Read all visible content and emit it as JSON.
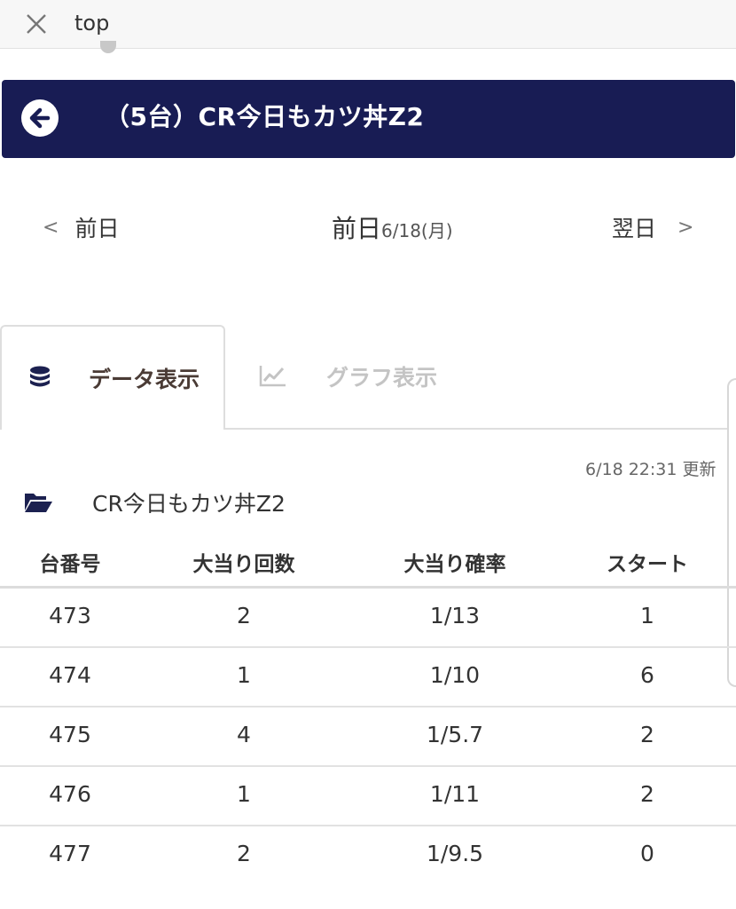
{
  "topbar": {
    "title": "top",
    "close_icon": "close-icon"
  },
  "banner": {
    "title": "（5台）CR今日もカツ丼Z2",
    "back_icon": "arrow-left-circle-icon",
    "bg_color": "#181c54"
  },
  "date_nav": {
    "prev_chevron": "<",
    "prev_label": "前日",
    "current_main": "前日",
    "current_date": "6/18(月)",
    "next_label": "翌日",
    "next_chevron": ">"
  },
  "tabs": [
    {
      "label": "データ表示",
      "icon": "database-icon",
      "active": true
    },
    {
      "label": "グラフ表示",
      "icon": "line-chart-icon",
      "active": false
    }
  ],
  "updated": "6/18 22:31 更新",
  "machine": {
    "icon": "folder-open-icon",
    "name": "CR今日もカツ丼Z2"
  },
  "table": {
    "headers": [
      "台番号",
      "大当り回数",
      "大当り確率",
      "スタート"
    ],
    "rows": [
      [
        "473",
        "2",
        "1/13",
        "1"
      ],
      [
        "474",
        "1",
        "1/10",
        "6"
      ],
      [
        "475",
        "4",
        "1/5.7",
        "2"
      ],
      [
        "476",
        "1",
        "1/11",
        "2"
      ],
      [
        "477",
        "2",
        "1/9.5",
        "0"
      ]
    ]
  }
}
